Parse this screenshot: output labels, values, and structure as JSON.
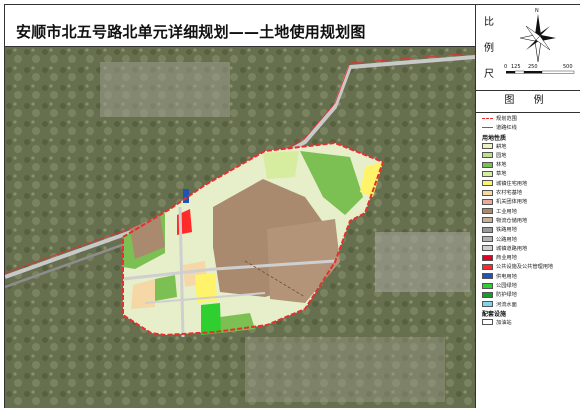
{
  "title": "安顺市北五号路北单元详细规划——土地使用规划图",
  "scale": {
    "label_chars": [
      "比",
      "例",
      "尺"
    ],
    "ticks": [
      "0",
      "125",
      "250",
      "500"
    ],
    "north_label": "N"
  },
  "legend": {
    "title": "图 例",
    "boundary_items": [
      {
        "label": "规划范围",
        "color": "#e53030",
        "style": "dash"
      },
      {
        "label": "道路红线",
        "color": "#e53030",
        "style": "line"
      }
    ],
    "landuse_header": "用地性质",
    "landuse_items": [
      {
        "label": "耕地",
        "color": "#eaf3c4"
      },
      {
        "label": "园地",
        "color": "#bde08c"
      },
      {
        "label": "林地",
        "color": "#7cbf52"
      },
      {
        "label": "草地",
        "color": "#d6ec9e"
      },
      {
        "label": "城镇住宅用地",
        "color": "#fff36a"
      },
      {
        "label": "农村宅基地",
        "color": "#f5d8a6"
      },
      {
        "label": "机关团体用地",
        "color": "#e9a9a0"
      },
      {
        "label": "工业用地",
        "color": "#a98a6e"
      },
      {
        "label": "物流仓储用地",
        "color": "#c7b299"
      },
      {
        "label": "铁路用地",
        "color": "#9a9a9a"
      },
      {
        "label": "公路用地",
        "color": "#b3b3b3"
      },
      {
        "label": "城镇道路用地",
        "color": "#cfcfcf"
      },
      {
        "label": "商业用地",
        "color": "#e0002a"
      },
      {
        "label": "公共设施及公共管理用地",
        "color": "#ff2a2a"
      },
      {
        "label": "供电用地",
        "color": "#1e55b5"
      },
      {
        "label": "公园绿地",
        "color": "#2fcf2f"
      },
      {
        "label": "防护绿地",
        "color": "#169c2c"
      },
      {
        "label": "河流水面",
        "color": "#7fd3f0"
      }
    ],
    "facility_header": "配套设施",
    "facility_items": [
      {
        "label": "加油站",
        "color": "#ffffff"
      }
    ]
  }
}
